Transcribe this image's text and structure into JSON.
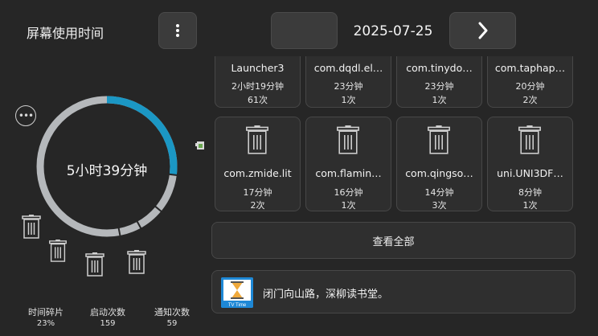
{
  "header": {
    "title": "屏幕使用时间",
    "date": "2025-07-25"
  },
  "summary": {
    "total_time": "5小时39分钟",
    "ring_usage_fraction": 0.27
  },
  "stats": [
    {
      "label": "时间碎片",
      "value": "23%"
    },
    {
      "label": "启动次数",
      "value": "159"
    },
    {
      "label": "通知次数",
      "value": "59"
    }
  ],
  "apps_row1": [
    {
      "name": "Launcher3",
      "duration": "2小时19分钟",
      "count": "61次"
    },
    {
      "name": "com.dqdl.el…",
      "duration": "23分钟",
      "count": "1次"
    },
    {
      "name": "com.tinydo…",
      "duration": "23分钟",
      "count": "1次"
    },
    {
      "name": "com.taphap…",
      "duration": "20分钟",
      "count": "2次"
    }
  ],
  "apps_row2": [
    {
      "name": "com.zmide.lit",
      "duration": "17分钟",
      "count": "2次"
    },
    {
      "name": "com.flamin…",
      "duration": "16分钟",
      "count": "1次"
    },
    {
      "name": "com.qingso…",
      "duration": "14分钟",
      "count": "3次"
    },
    {
      "name": "uni.UNI3DF…",
      "duration": "8分钟",
      "count": "1次"
    }
  ],
  "view_all_label": "查看全部",
  "quote": {
    "text": "闭门向山路，深柳读书堂。",
    "logo_caption": "TV Time"
  },
  "icons": {
    "menu": "vertical-dots-icon",
    "next": "chevron-right-icon",
    "more": "ellipsis-icon",
    "app": "trash-icon"
  },
  "colors": {
    "background": "#262626",
    "ring_accent": "#1b97c4",
    "ring_track": "#b5b8bb",
    "logo_blue": "#1e88d6"
  }
}
